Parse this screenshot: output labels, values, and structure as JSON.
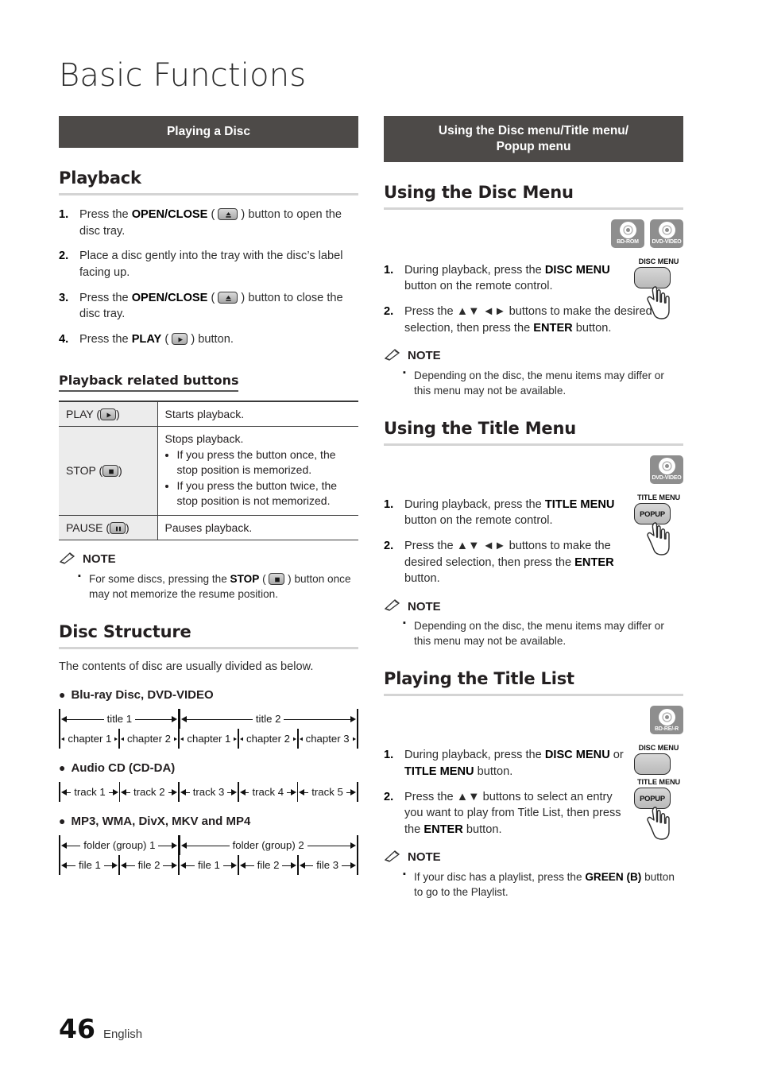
{
  "page": {
    "title": "Basic Functions",
    "number": "46",
    "language": "English"
  },
  "left": {
    "section_bar": "Playing a Disc",
    "playback": {
      "heading": "Playback",
      "steps": [
        {
          "num": "1.",
          "pre": "Press the ",
          "bold": "OPEN/CLOSE",
          "icon": "eject-icon",
          "post": " ) button to open the disc tray."
        },
        {
          "num": "2.",
          "pre": "Place a disc gently into the tray with the disc’s label facing up.",
          "bold": "",
          "icon": "",
          "post": ""
        },
        {
          "num": "3.",
          "pre": "Press the ",
          "bold": "OPEN/CLOSE",
          "icon": "eject-icon",
          "post": " ) button to close the disc tray."
        },
        {
          "num": "4.",
          "pre": "Press the ",
          "bold": "PLAY",
          "icon": "play-icon",
          "post": " ) button."
        }
      ]
    },
    "related_buttons": {
      "heading": "Playback related buttons",
      "rows": [
        {
          "key": "PLAY (",
          "key_icon": "play-icon",
          "key_post": ")",
          "desc": "Starts playback.",
          "bullets": []
        },
        {
          "key": "STOP (",
          "key_icon": "stop-icon",
          "key_post": ")",
          "desc": "Stops playback.",
          "bullets": [
            "If you press the button once, the stop position is memorized.",
            "If you press the button twice, the stop position is not memorized."
          ]
        },
        {
          "key": "PAUSE (",
          "key_icon": "pause-icon",
          "key_post": ")",
          "desc": "Pauses playback.",
          "bullets": []
        }
      ]
    },
    "note": {
      "label": "NOTE",
      "item_pre": "For some discs, pressing the ",
      "item_bold": "STOP",
      "item_post": " ) button once may not memorize the resume position."
    },
    "disc_structure": {
      "heading": "Disc Structure",
      "intro": "The contents of disc are usually divided as below.",
      "groups": [
        {
          "label": "Blu-ray Disc, DVD-VIDEO",
          "top_row": [
            "title 1",
            "title 2"
          ],
          "bottom_row": [
            "chapter 1",
            "chapter 2",
            "chapter 1",
            "chapter 2",
            "chapter 3"
          ]
        },
        {
          "label": "Audio CD (CD-DA)",
          "top_row": [],
          "bottom_row": [
            "track 1",
            "track 2",
            "track 3",
            "track 4",
            "track 5"
          ]
        },
        {
          "label": "MP3, WMA, DivX, MKV and MP4",
          "top_row": [
            "folder (group) 1",
            "folder (group) 2"
          ],
          "bottom_row": [
            "file 1",
            "file 2",
            "file 1",
            "file 2",
            "file 3"
          ]
        }
      ]
    }
  },
  "right": {
    "section_bar_line1": "Using the Disc menu/Title menu/",
    "section_bar_line2": "Popup menu",
    "disc_menu": {
      "heading": "Using the Disc Menu",
      "badges": [
        {
          "name": "bd-rom-badge",
          "label": "BD-ROM"
        },
        {
          "name": "dvd-video-badge",
          "label": "DVD-VIDEO"
        }
      ],
      "remote_label": "DISC MENU",
      "remote_cap": "",
      "steps": [
        {
          "num": "1.",
          "pre": "During playback, press the ",
          "bold": "DISC MENU",
          "post": " button on the remote control."
        },
        {
          "num": "2.",
          "pre": "Press the ▲▼ ◄► buttons to make the desired selection, then press the ",
          "bold": "ENTER",
          "post": " button."
        }
      ],
      "note": {
        "label": "NOTE",
        "item": "Depending on the disc, the menu items may differ or this menu may not be available."
      }
    },
    "title_menu": {
      "heading": "Using the Title Menu",
      "badges": [
        {
          "name": "dvd-video-badge",
          "label": "DVD-VIDEO"
        }
      ],
      "remote_label": "TITLE MENU",
      "remote_cap": "POPUP",
      "steps": [
        {
          "num": "1.",
          "pre": "During playback, press the ",
          "bold": "TITLE MENU",
          "post": " button on the remote control."
        },
        {
          "num": "2.",
          "pre": "Press the ▲▼ ◄► buttons to make the desired selection, then press the ",
          "bold": "ENTER",
          "post": " button."
        }
      ],
      "note": {
        "label": "NOTE",
        "item": "Depending on the disc, the menu items may differ or this menu may not be available."
      }
    },
    "title_list": {
      "heading": "Playing the Title List",
      "badges": [
        {
          "name": "bd-re-r-badge",
          "label": "BD-RE/-R"
        }
      ],
      "remote_label_1": "DISC MENU",
      "remote_label_2": "TITLE MENU",
      "remote_cap_2": "POPUP",
      "steps": [
        {
          "num": "1.",
          "pre": "During playback, press the ",
          "bold": "DISC MENU",
          "mid": " or ",
          "bold2": "TITLE MENU",
          "post": " button."
        },
        {
          "num": "2.",
          "pre": "Press the ▲▼ buttons to select an entry you want to play from Title List, then press the ",
          "bold": "ENTER",
          "post": " button."
        }
      ],
      "note": {
        "label": "NOTE",
        "item_pre": "If your disc has a playlist, press the ",
        "item_bold": "GREEN (B)",
        "item_post": " button to go to the Playlist."
      }
    }
  }
}
